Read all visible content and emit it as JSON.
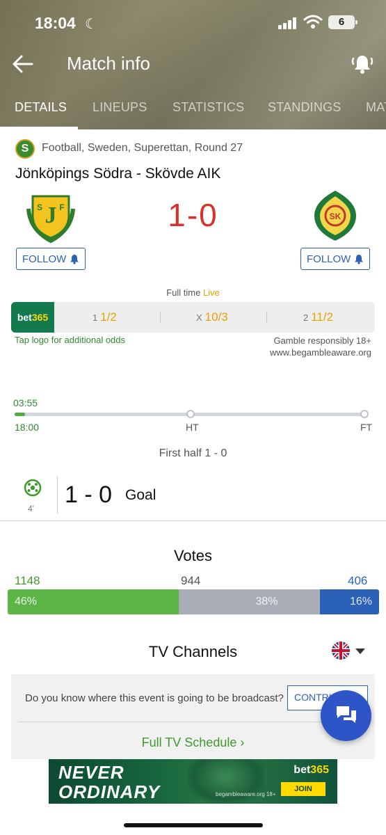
{
  "status_bar": {
    "time": "18:04",
    "battery": "6"
  },
  "header": {
    "title": "Match info"
  },
  "tabs": [
    {
      "label": "DETAILS",
      "active": true
    },
    {
      "label": "LINEUPS"
    },
    {
      "label": "STATISTICS"
    },
    {
      "label": "STANDINGS"
    },
    {
      "label": "MAT"
    }
  ],
  "match": {
    "league": "Football, Sweden, Superettan, Round 27",
    "title": "Jönköpings Södra - Skövde AIK",
    "score": "1-0",
    "follow_label": "FOLLOW",
    "status": "Full time",
    "live": "Live"
  },
  "odds": {
    "bookmaker": {
      "part1": "bet",
      "part2": "365"
    },
    "items": [
      {
        "key": "1",
        "value": "1/2"
      },
      {
        "key": "X",
        "value": "10/3"
      },
      {
        "key": "2",
        "value": "11/2"
      }
    ],
    "tap_logo": "Tap logo for additional odds",
    "gamble_line1": "Gamble responsibly 18+",
    "gamble_line2": "www.begambleaware.org"
  },
  "timeline": {
    "current_time": "03:55",
    "start": "18:00",
    "half": "HT",
    "end": "FT",
    "progress_fraction": 0.03
  },
  "events": {
    "first_half": "First half 1 - 0",
    "goal": {
      "minute": "4'",
      "score": "1 - 0",
      "label": "Goal"
    }
  },
  "votes": {
    "title": "Votes",
    "home": {
      "count": "1148",
      "percent": "46%",
      "fraction": 0.46,
      "color": "#5cb546"
    },
    "draw": {
      "count": "944",
      "percent": "38%",
      "fraction": 0.38,
      "color": "#a8adb7"
    },
    "away": {
      "count": "406",
      "percent": "16%",
      "fraction": 0.16,
      "color": "#2b61b7"
    }
  },
  "tv": {
    "title": "TV Channels",
    "question": "Do you know where this event is going to be broadcast?",
    "contribute": "CONTRIBUTE",
    "schedule": "Full TV Schedule"
  },
  "ad": {
    "line1": "NEVER",
    "line2": "ORDINARY",
    "brand_part1": "bet",
    "brand_part2": "365",
    "join": "JOIN",
    "small": "begambleaware.org  18+"
  },
  "colors": {
    "accent_green": "#3f9a2e",
    "score_red": "#d7332c",
    "link_blue": "#2b61b7",
    "odds_orange": "#e6a100"
  }
}
